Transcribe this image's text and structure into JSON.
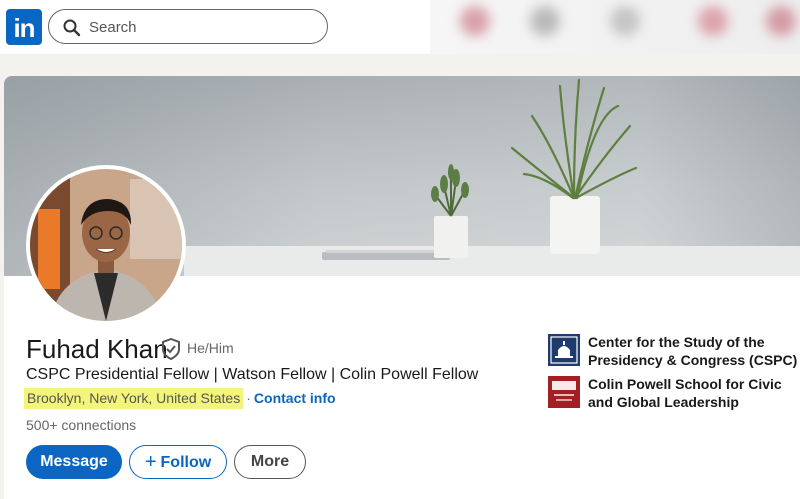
{
  "search": {
    "placeholder": "Search"
  },
  "brand": {
    "logo_text": "in",
    "color": "#0a66c2"
  },
  "profile": {
    "name": "Fuhad Khan",
    "pronouns": "He/Him",
    "headline": "CSPC Presidential Fellow | Watson Fellow | Colin Powell Fellow",
    "location": "Brooklyn, New York, United States",
    "separator": "·",
    "contact_label": "Contact info",
    "connections": "500+ connections",
    "verified_icon": "shield-check-icon"
  },
  "actions": {
    "message_label": "Message",
    "follow_label": "Follow",
    "more_label": "More"
  },
  "organizations": [
    {
      "name": "Center for the Study of the Presidency & Congress (CSPC)",
      "logo": "capitol-logo",
      "color": "#1f3a6e"
    },
    {
      "name": "Colin Powell School for Civic and Global Leadership",
      "logo": "ccny-logo",
      "color": "#a31f24"
    }
  ]
}
